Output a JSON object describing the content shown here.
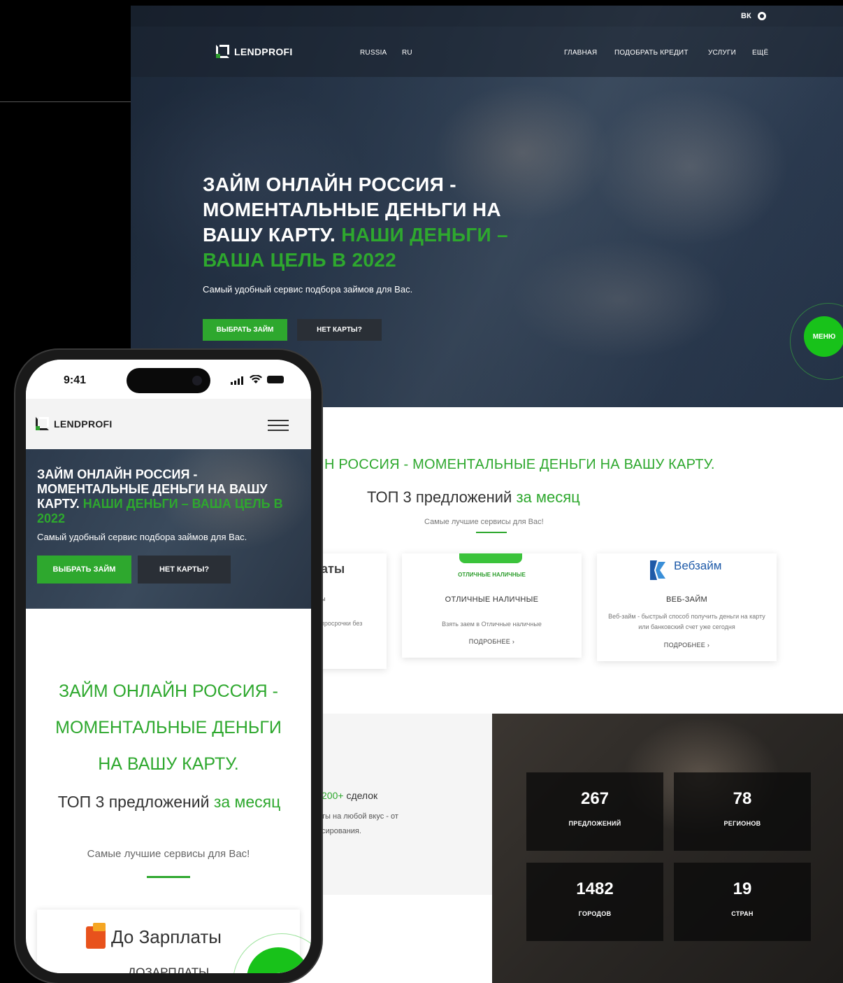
{
  "desktop": {
    "social": [
      "vk",
      "ok"
    ],
    "logo": "LENDPROFI",
    "nav_left": [
      "RUSSIA",
      "RU"
    ],
    "nav_right": [
      "ГЛАВНАЯ",
      "ПОДОБРАТЬ КРЕДИТ",
      "УСЛУГИ",
      "ЕЩЁ"
    ],
    "hero_title_white": "ЗАЙМ ОНЛАЙН РОССИЯ - МОМЕНТАЛЬНЫЕ ДЕНЬГИ НА ВАШУ КАРТУ.",
    "hero_title_green": "НАШИ ДЕНЬГИ – ВАША ЦЕЛЬ В 2022",
    "hero_subtitle": "Самый удобный сервис подбора займов для Вас.",
    "btn_choose": "ВЫБРАТЬ ЗАЙМ",
    "btn_no_card": "НЕТ КАРТЫ?",
    "menu_label": "МЕНЮ",
    "section_title": "Н РОССИЯ - МОМЕНТАЛЬНЫЕ ДЕНЬГИ НА ВАШУ КАРТУ.",
    "top3_black": "ТОП 3 предложений",
    "top3_green": "за месяц",
    "section_note": "Самые лучшие сервисы для Вас!",
    "card_partial": {
      "title": "аты",
      "line1": "ы",
      "line2": "просрочки без"
    },
    "cards": [
      {
        "name": "ОТЛИЧНЫЕ НАЛИЧНЫЕ",
        "logo_text": "ОТЛИЧНЫЕ НАЛИЧНЫЕ",
        "desc": "Взять заем в Отличные наличные",
        "more": "ПОДРОБНЕЕ ›"
      },
      {
        "name": "ВЕБ-ЗАЙМ",
        "logo_text": "Вебзайм",
        "desc": "Веб-займ - быстрый способ получить деньги на карту или банковский счет уже сегодня",
        "more": "ПОДРОБНЕЕ ›"
      }
    ],
    "deals_green": "200+",
    "deals_black": "сделок",
    "deals_text_1": "ты на любой вкус - от",
    "deals_text_2": "сирования.",
    "stats": [
      {
        "num": "267",
        "label": "ПРЕДЛОЖЕНИЙ"
      },
      {
        "num": "78",
        "label": "РЕГИОНОВ"
      },
      {
        "num": "1482",
        "label": "ГОРОДОВ"
      },
      {
        "num": "19",
        "label": "СТРАН"
      }
    ]
  },
  "phone": {
    "time": "9:41",
    "logo": "LENDPROFI",
    "hero_title_white": "ЗАЙМ ОНЛАЙН РОССИЯ - МОМЕНТАЛЬНЫЕ ДЕНЬГИ НА ВАШУ КАРТУ.",
    "hero_title_green": "НАШИ ДЕНЬГИ – ВАША ЦЕЛЬ В 2022",
    "hero_subtitle": "Самый удобный сервис подбора займов для Вас.",
    "btn_choose": "ВЫБРАТЬ ЗАЙМ",
    "btn_no_card": "НЕТ КАРТЫ?",
    "section_title_lines": [
      "ЗАЙМ ОНЛАЙН РОССИЯ -",
      "МОМЕНТАЛЬНЫЕ ДЕНЬГИ",
      "НА ВАШУ КАРТУ."
    ],
    "top3_black": "ТОП 3 предложений",
    "top3_green": "за месяц",
    "section_note": "Самые лучшие сервисы для Вас!",
    "card_logo": "До Зарплаты",
    "card_name_partial": "ДОЗАРПЛАТЫ"
  },
  "colors": {
    "accent": "#2ea82e",
    "menu": "#18c21a"
  }
}
